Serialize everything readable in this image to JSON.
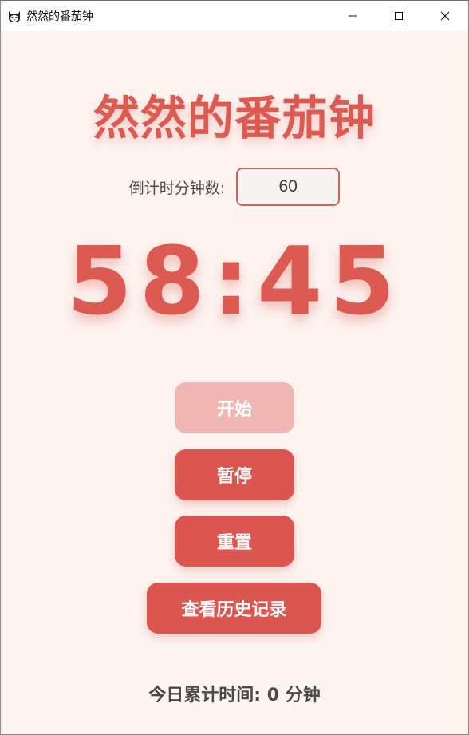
{
  "window": {
    "title": "然然的番茄钟",
    "app_icon": "cat-face-icon",
    "controls": [
      "minimize-icon",
      "maximize-icon",
      "close-icon"
    ]
  },
  "main": {
    "heading": "然然的番茄钟",
    "minutes_label": "倒计时分钟数:",
    "minutes_value": "60",
    "timer_display": "58:45",
    "buttons": {
      "start": {
        "label": "开始",
        "disabled": true
      },
      "pause": {
        "label": "暂停",
        "disabled": false
      },
      "reset": {
        "label": "重置",
        "disabled": false
      },
      "history": {
        "label": "查看历史记录",
        "disabled": false
      }
    },
    "total_label": "今日累计时间: 0 分钟"
  },
  "colors": {
    "background": "#fdf3ef",
    "accent": "#dc5a52",
    "disabled_button": "#efb6b4"
  }
}
